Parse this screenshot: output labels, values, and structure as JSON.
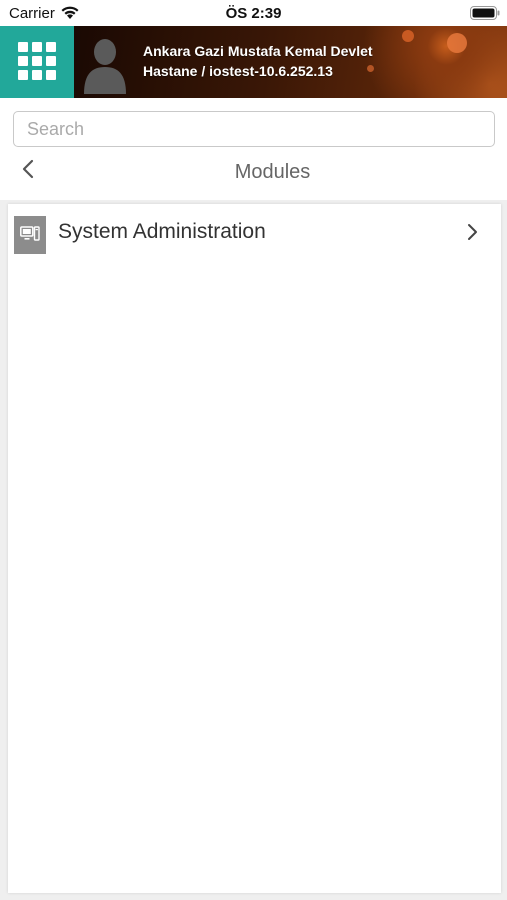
{
  "status_bar": {
    "carrier": "Carrier",
    "time": "ÖS 2:39",
    "wifi_icon": "wifi-icon",
    "battery_icon": "battery-full-icon"
  },
  "header": {
    "menu_icon": "grid-icon",
    "avatar_icon": "user-silhouette-icon",
    "hospital_line1": "Ankara Gazi Mustafa Kemal Devlet",
    "hospital_line2": "Hastane / iostest-10.6.252.13",
    "accent_color": "#22a89a"
  },
  "search": {
    "placeholder": "Search",
    "value": ""
  },
  "nav": {
    "back_icon": "chevron-left-icon",
    "title": "Modules"
  },
  "modules": [
    {
      "label": "System Administration",
      "icon": "computer-icon",
      "chevron": "chevron-right-icon"
    }
  ]
}
